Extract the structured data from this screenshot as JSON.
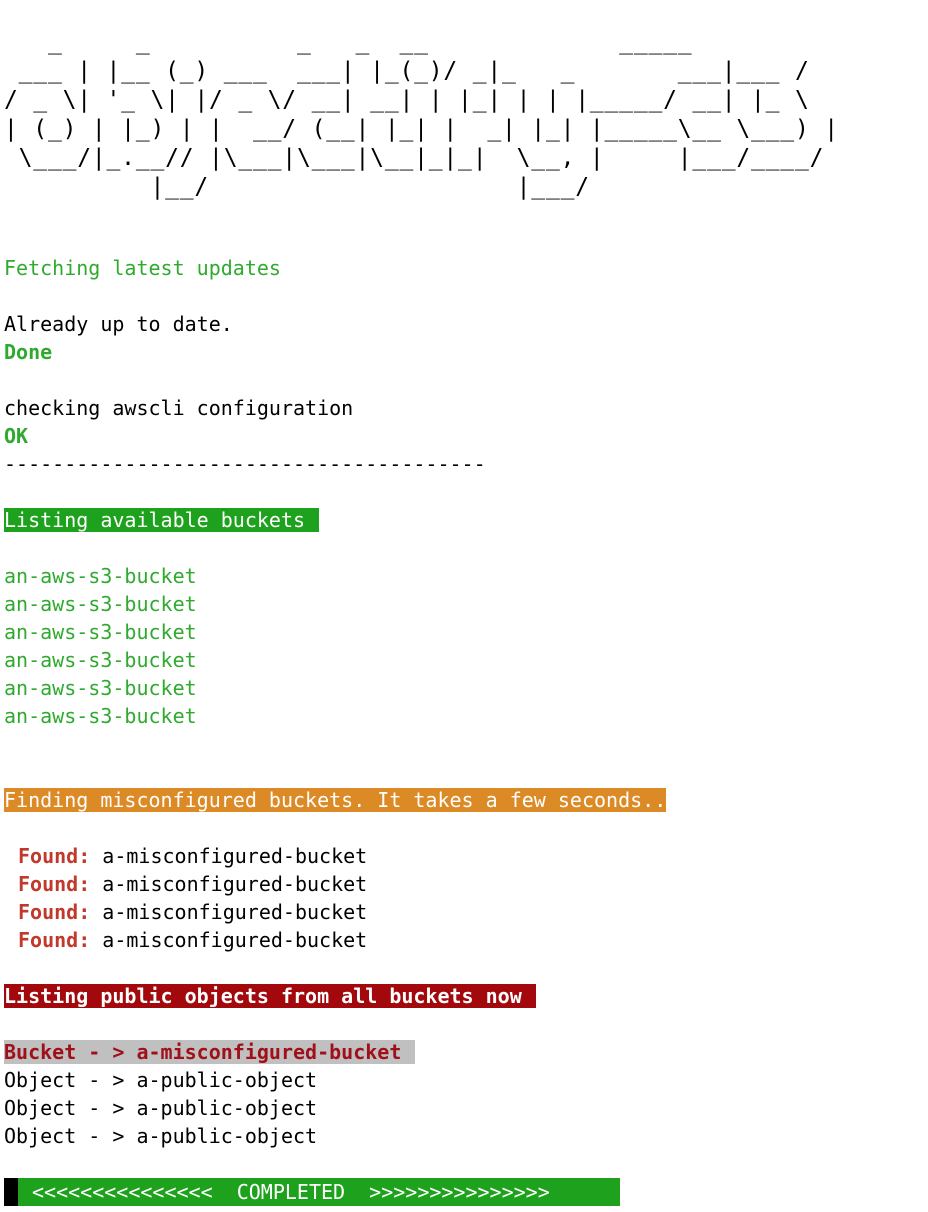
{
  "banner": {
    "ascii_art": "   _     _          _   _  __             _____\n ___ | |__ (_) ___  ___| |_(_)/ _|_   _       ___|___ /\n/ _ \\| '_ \\| |/ _ \\/ __| __| | |_| | | |_____/ __| |_ \\\n| (_) | |_) | |  __/ (__| |_| |  _| |_| |_____\\__ \\___) |\n \\___/|_.__// |\\___|\\___|\\__|_|_|  \\__, |     |___/____/\n          |__/                     |___/"
  },
  "output": {
    "fetching": "Fetching latest updates",
    "up_to_date": "Already up to date.",
    "done": "Done",
    "checking": "checking awscli configuration",
    "ok": "OK",
    "separator": "----------------------------------------",
    "listing_buckets": "Listing available buckets",
    "buckets": [
      "an-aws-s3-bucket",
      "an-aws-s3-bucket",
      "an-aws-s3-bucket",
      "an-aws-s3-bucket",
      "an-aws-s3-bucket",
      "an-aws-s3-bucket"
    ],
    "finding": "Finding misconfigured buckets. It takes a few seconds..",
    "found_label": "Found:",
    "found": [
      "a-misconfigured-bucket",
      "a-misconfigured-bucket",
      "a-misconfigured-bucket",
      "a-misconfigured-bucket"
    ],
    "listing_public": "Listing public objects from all buckets now",
    "bucket_line": "Bucket - > a-misconfigured-bucket",
    "objects": [
      "Object - > a-public-object",
      "Object - > a-public-object",
      "Object - > a-public-object"
    ],
    "completed": "<<<<<<<<<<<<<<<  COMPLETED  >>>>>>>>>>>>>>>"
  },
  "colors": {
    "green_text": "#2faa2f",
    "green_highlight": "#1ea21e",
    "orange_highlight": "#dc8a25",
    "red_highlight": "#a2080c",
    "found_red": "#c0392b",
    "grey_highlight": "#c0c0c0"
  }
}
